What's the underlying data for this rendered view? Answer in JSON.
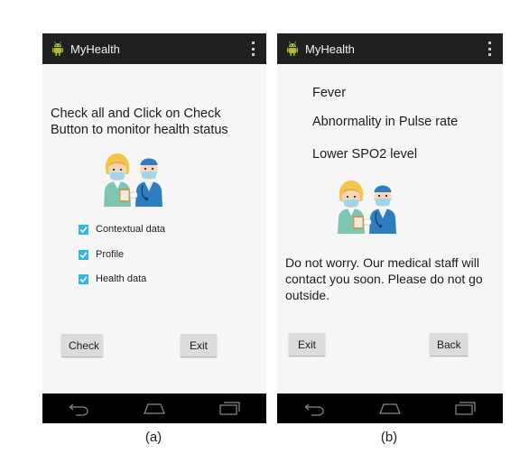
{
  "app": {
    "title": "MyHealth",
    "icon": "android-robot-icon",
    "accent_color": "#33b5e5",
    "actionbar_color": "#202020",
    "icon_color": "#96c224"
  },
  "screen_a": {
    "instruction": "Check all and Click on Check Button to monitor health status",
    "image": "doctors-illustration",
    "checkboxes": [
      {
        "label": "Contextual data",
        "checked": true
      },
      {
        "label": "Profile",
        "checked": true
      },
      {
        "label": "Health data",
        "checked": true
      }
    ],
    "buttons": {
      "check": "Check",
      "exit": "Exit"
    },
    "caption": "(a)"
  },
  "screen_b": {
    "symptoms": [
      "Fever",
      "Abnormality in Pulse rate",
      "Lower SPO2 level"
    ],
    "image": "doctors-illustration",
    "advice": "Do not worry. Our medical staff will contact you soon. Please do not go outside.",
    "buttons": {
      "exit": "Exit",
      "back": "Back"
    },
    "caption": "(b)"
  },
  "navbar": {
    "icons": [
      "back-nav-icon",
      "home-nav-icon",
      "recents-nav-icon"
    ]
  }
}
